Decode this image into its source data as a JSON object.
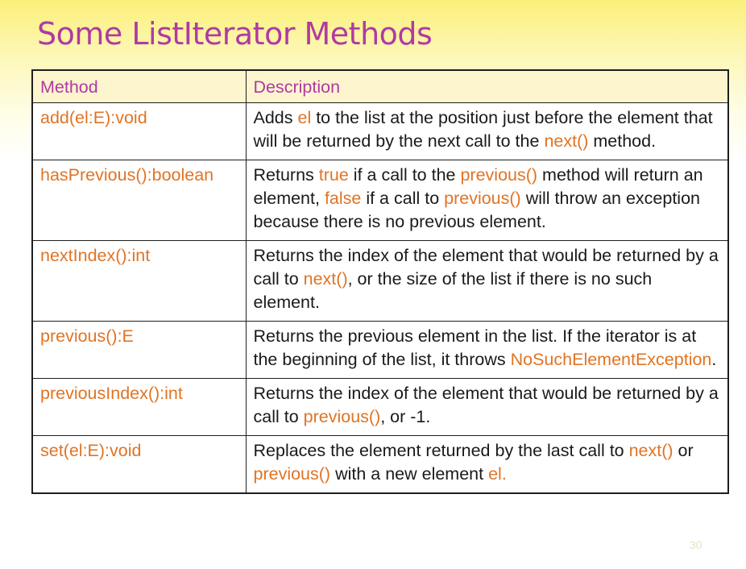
{
  "title": "Some ListIterator Methods",
  "table": {
    "headers": {
      "method": "Method",
      "description": "Description"
    },
    "rows": [
      {
        "method": "add(el:E):void",
        "description": [
          "Adds ",
          "el",
          " to the list at the position just before the element that will be returned by the next call to the ",
          "next()",
          " method."
        ]
      },
      {
        "method": "hasPrevious():boolean",
        "description": [
          "Returns ",
          "true",
          " if a call to the ",
          "previous()",
          " method will return an element, ",
          "false",
          " if a call to ",
          "previous()",
          " will throw an exception because there is no previous element."
        ]
      },
      {
        "method": "nextIndex():int",
        "description": [
          "Returns the index of the element that would be returned by a call to ",
          "next()",
          ", or the size of the list if there is no such element."
        ]
      },
      {
        "method": "previous():E",
        "description": [
          "Returns the previous element in the list. If the iterator is at the beginning of the list, it throws ",
          "NoSuchElementException",
          "."
        ]
      },
      {
        "method": "previousIndex():int",
        "description": [
          "Returns the index of the element that would be returned by a call to ",
          "previous()",
          ", or -1."
        ]
      },
      {
        "method": "set(el:E):void",
        "description": [
          "Replaces the element returned by the last call to ",
          "next()",
          " or ",
          "previous()",
          " with a new element ",
          "el."
        ]
      }
    ]
  },
  "page_number": "30",
  "colors": {
    "title": "#b03aa2",
    "header_text": "#b03aa2",
    "code_text": "#e07424",
    "header_bg": "#fdf5ce"
  }
}
